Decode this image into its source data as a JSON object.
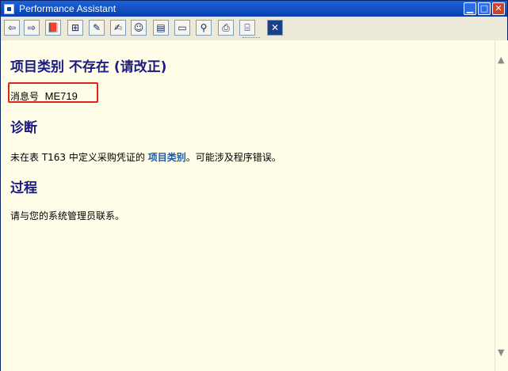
{
  "window": {
    "title": "Performance Assistant"
  },
  "toolbar": {
    "buttons": [
      {
        "name": "back-icon",
        "glyph": "⇦"
      },
      {
        "name": "forward-icon",
        "glyph": "⇨"
      },
      {
        "name": "book-icon",
        "glyph": "📕"
      },
      {
        "name": "structure-icon",
        "glyph": "⊞"
      },
      {
        "name": "edit-icon",
        "glyph": "✎"
      },
      {
        "name": "edit-doc-icon",
        "glyph": "✍"
      },
      {
        "name": "users-icon",
        "glyph": "☺"
      },
      {
        "name": "list-icon",
        "glyph": "▤"
      },
      {
        "name": "card-icon",
        "glyph": "▭"
      },
      {
        "name": "pin-icon",
        "glyph": "⚲"
      },
      {
        "name": "print-icon",
        "glyph": "⎙"
      },
      {
        "name": "save-icon",
        "glyph": "⌸"
      },
      {
        "name": "close-icon",
        "glyph": "✕"
      }
    ]
  },
  "message": {
    "title": "项目类别  不存在  (请改正)",
    "number_label": "消息号",
    "number_value": "ME719"
  },
  "diagnosis": {
    "heading": "诊断",
    "text_before": "未在表  T163 中定义采购凭证的 ",
    "link": "项目类别",
    "text_after": "。可能涉及程序错误。"
  },
  "procedure": {
    "heading": "过程",
    "text": "请与您的系统管理员联系。"
  },
  "colors": {
    "heading": "#1a1a80",
    "link": "#1a5aa8",
    "content_bg": "#fffde8",
    "highlight": "#e0251b"
  }
}
